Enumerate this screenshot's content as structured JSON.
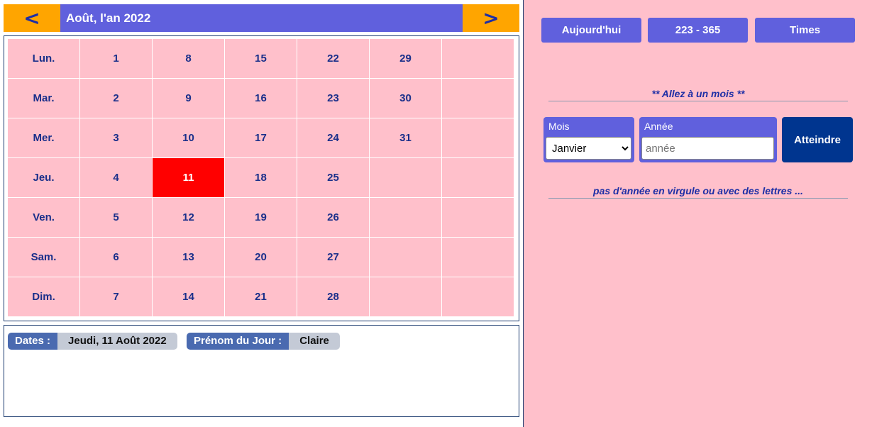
{
  "header": {
    "prev_label": "<",
    "next_label": ">",
    "title": "Août, l'an 2022"
  },
  "calendar": {
    "rows": [
      [
        "Lun.",
        "1",
        "8",
        "15",
        "22",
        "29",
        ""
      ],
      [
        "Mar.",
        "2",
        "9",
        "16",
        "23",
        "30",
        ""
      ],
      [
        "Mer.",
        "3",
        "10",
        "17",
        "24",
        "31",
        ""
      ],
      [
        "Jeu.",
        "4",
        "11",
        "18",
        "25",
        "",
        ""
      ],
      [
        "Ven.",
        "5",
        "12",
        "19",
        "26",
        "",
        ""
      ],
      [
        "Sam.",
        "6",
        "13",
        "20",
        "27",
        "",
        ""
      ],
      [
        "Dim.",
        "7",
        "14",
        "21",
        "28",
        "",
        ""
      ]
    ],
    "selected_day": "11",
    "colors": {
      "cell": "#ffc0cb",
      "selected": "#ff0000",
      "text": "#1a2f8a"
    }
  },
  "info": {
    "date_label": "Dates :",
    "date_value": "Jeudi, 11 Août 2022",
    "name_label": "Prénom du Jour :",
    "name_value": "Claire"
  },
  "actions": {
    "today_label": "Aujourd'hui",
    "daycount_label": "223 - 365",
    "times_label": "Times"
  },
  "goto": {
    "title": "** Allez à un mois **",
    "month_label": "Mois",
    "month_selected": "Janvier",
    "year_label": "Année",
    "year_placeholder": "année",
    "submit_label": "Atteindre",
    "warning": "pas d'année en virgule ou avec des lettres ..."
  }
}
